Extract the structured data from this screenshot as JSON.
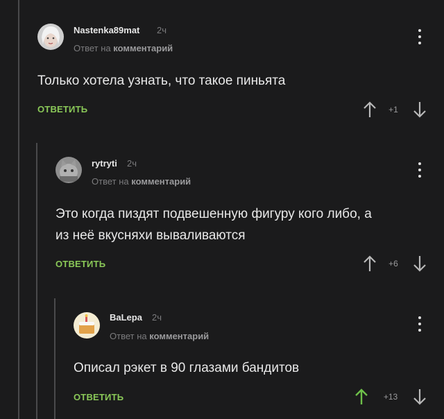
{
  "comments": [
    {
      "author": "Nastenka89mat",
      "time": "2ч",
      "reply_prefix": "Ответ на",
      "reply_target": "комментарий",
      "text": "Только хотела узнать, что такое пиньята",
      "reply_label": "ОТВЕТИТЬ",
      "rating": "+1"
    },
    {
      "author": "rytryti",
      "time": "2ч",
      "reply_prefix": "Ответ на",
      "reply_target": "комментарий",
      "text_line1": "Это когда пиздят подвешенную фигуру кого либо, а",
      "text_line2": "из неё вкусняхи вываливаются",
      "reply_label": "ОТВЕТИТЬ",
      "rating": "+6"
    },
    {
      "author": "BaLepa",
      "time": "2ч",
      "reply_prefix": "Ответ на",
      "reply_target": "комментарий",
      "text": "Описал рэкет в 90 глазами бандитов",
      "reply_label": "ОТВЕТИТЬ",
      "rating": "+13"
    }
  ],
  "colors": {
    "background": "#1b1b1c",
    "reply_green": "#8ac858",
    "upvoted_green": "#6ec04a",
    "muted": "#7b7b7d",
    "thread_line": "#4a4a4c"
  },
  "icons": {
    "menu": "more-vertical-icon",
    "upvote": "arrow-up-icon",
    "downvote": "arrow-down-icon"
  }
}
